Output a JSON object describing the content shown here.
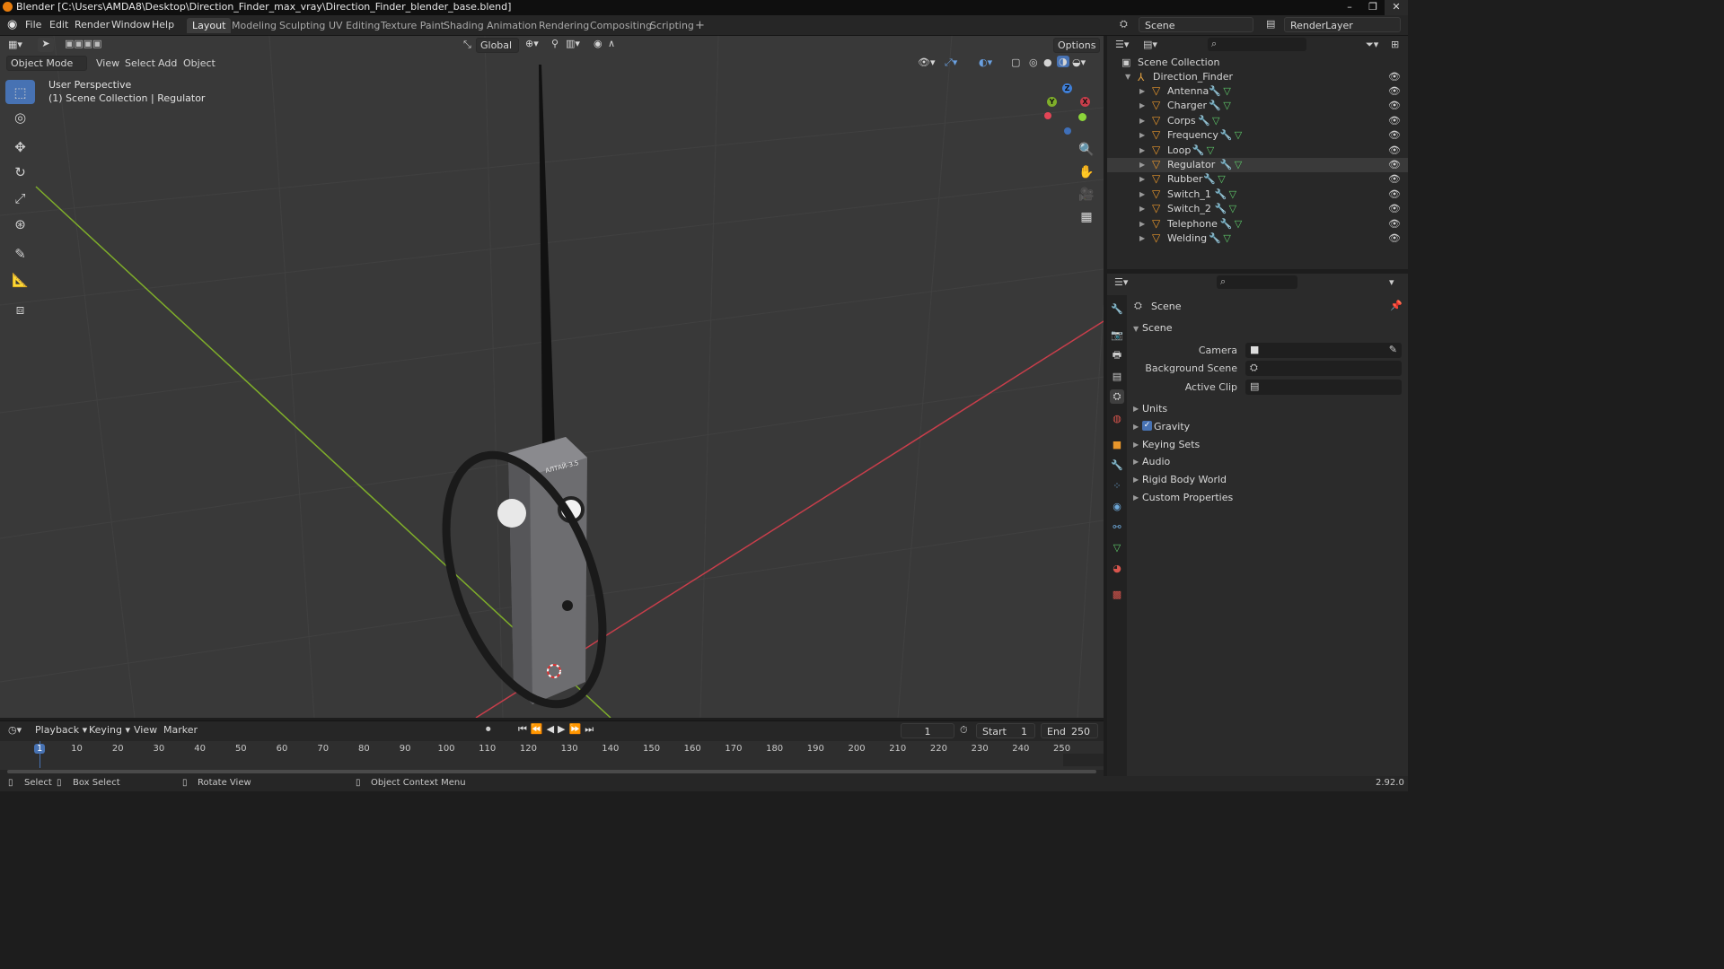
{
  "window": {
    "title": "Blender [C:\\Users\\AMDA8\\Desktop\\Direction_Finder_max_vray\\Direction_Finder_blender_base.blend]",
    "controls": [
      "–",
      "❐",
      "✕"
    ]
  },
  "menu": [
    "File",
    "Edit",
    "Render",
    "Window",
    "Help"
  ],
  "workspaces": [
    "Layout",
    "Modeling",
    "Sculpting",
    "UV Editing",
    "Texture Paint",
    "Shading",
    "Animation",
    "Rendering",
    "Compositing",
    "Scripting"
  ],
  "active_workspace": "Layout",
  "add_workspace": "+",
  "scene_field": "Scene",
  "render_layer_field": "RenderLayer",
  "viewport": {
    "transform_orientation": "Global",
    "options_label": "Options",
    "mode": "Object Mode",
    "header_menus": [
      "View",
      "Select",
      "Add",
      "Object"
    ],
    "overlay_line1": "User Perspective",
    "overlay_line2": "(1) Scene Collection | Regulator",
    "gizmo_axes": {
      "z": "Z",
      "y": "Y",
      "x": "X"
    },
    "device_labels": {
      "brand": "АЛТАЙ-3.5"
    }
  },
  "outliner": {
    "root": "Scene Collection",
    "collection": "Direction_Finder",
    "objects": [
      "Antenna",
      "Charger",
      "Corps",
      "Frequency",
      "Loop",
      "Regulator",
      "Rubber",
      "Switch_1",
      "Switch_2",
      "Telephone",
      "Welding"
    ],
    "selected": "Regulator"
  },
  "properties": {
    "context": "Scene",
    "panel_title": "Scene",
    "fields": [
      {
        "label": "Camera",
        "value": ""
      },
      {
        "label": "Background Scene",
        "value": ""
      },
      {
        "label": "Active Clip",
        "value": ""
      }
    ],
    "subpanels": [
      "Units",
      "Gravity",
      "Keying Sets",
      "Audio",
      "Rigid Body World",
      "Custom Properties"
    ],
    "gravity_checked": true
  },
  "timeline": {
    "menus": [
      "Playback",
      "Keying",
      "View",
      "Marker"
    ],
    "current_frame": "1",
    "start_label": "Start",
    "start": "1",
    "end_label": "End",
    "end": "250",
    "ruler": [
      "1",
      "10",
      "20",
      "30",
      "40",
      "50",
      "60",
      "70",
      "80",
      "90",
      "100",
      "110",
      "120",
      "130",
      "140",
      "150",
      "160",
      "170",
      "180",
      "190",
      "200",
      "210",
      "220",
      "230",
      "240",
      "250"
    ]
  },
  "statusbar": {
    "items": [
      "Select",
      "Box Select",
      "Rotate View",
      "Object Context Menu"
    ],
    "version": "2.92.0"
  },
  "colors": {
    "accent": "#4772b3",
    "object_icon": "#e8962b",
    "x_axis": "#c83e4b",
    "y_axis": "#7fae2a",
    "viewport_bg": "#393939"
  }
}
